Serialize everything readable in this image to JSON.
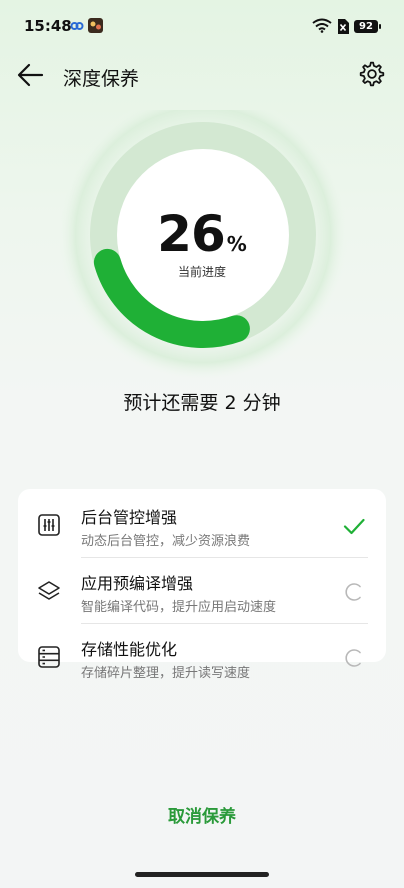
{
  "status_bar": {
    "time": "15:48",
    "battery": "92"
  },
  "header": {
    "title": "深度保养"
  },
  "progress": {
    "percent": "26",
    "percent_sign": "%",
    "label": "当前进度",
    "fraction": 0.26
  },
  "eta": "预计还需要 2 分钟",
  "tasks": [
    {
      "name": "后台管控增强",
      "desc": "动态后台管控，减少资源浪费",
      "state": "done"
    },
    {
      "name": "应用预编译增强",
      "desc": "智能编译代码，提升应用启动速度",
      "state": "running"
    },
    {
      "name": "存储性能优化",
      "desc": "存储碎片整理，提升读写速度",
      "state": "running"
    }
  ],
  "cancel_label": "取消保养",
  "colors": {
    "accent": "#1fb036",
    "cancel": "#2a9a3a"
  }
}
